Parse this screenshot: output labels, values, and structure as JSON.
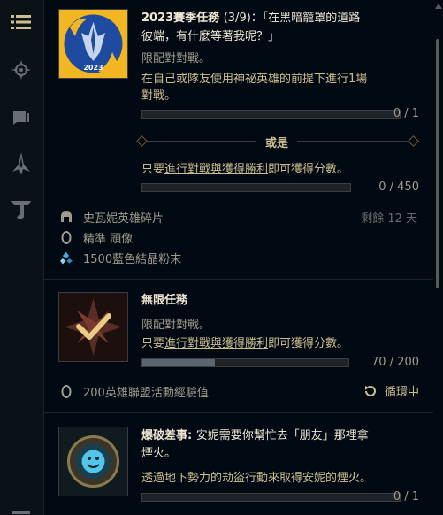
{
  "sidebar": {
    "items": [
      {
        "name": "list-icon",
        "active": true
      },
      {
        "name": "compass-icon"
      },
      {
        "name": "book-icon"
      },
      {
        "name": "crest-icon"
      },
      {
        "name": "tft-icon"
      }
    ]
  },
  "missions": [
    {
      "title": "2023賽季任務",
      "title_rest": "(3/9)：「在黑暗籠罩的道路",
      "title_line2": "彼端，有什麼等著我呢？」",
      "restriction": "限配對對戰。",
      "objective1_line1": "在自己或隊友使用神祕英雄的前提下進行1場",
      "objective1_line2": "對戰。",
      "progress1": "0 / 1",
      "progress1_fraction": 0,
      "or_label": "或是",
      "objective2_prefix": "只要",
      "objective2_link": "進行對戰與獲得勝利",
      "objective2_suffix": "即可獲得分數。",
      "progress2": "0 / 450",
      "progress2_fraction": 0,
      "emblem_text": "2023",
      "rewards": [
        {
          "icon": "helmet-icon",
          "label": "史瓦妮英雄碎片"
        },
        {
          "icon": "shield-icon",
          "label": "精準 頭像"
        },
        {
          "icon": "crystal-icon",
          "label": "1500藍色結晶粉末"
        }
      ],
      "time_left": "剩餘 12 天"
    },
    {
      "title": "無限任務",
      "restriction": "限配對對戰。",
      "objective_prefix": "只要",
      "objective_link": "進行對戰與獲得勝利",
      "objective_suffix": "即可獲得分數。",
      "progress": "70 / 200",
      "progress_fraction": 0.35,
      "rewards": [
        {
          "icon": "shield-icon",
          "label": "200英雄聯盟活動經驗值"
        }
      ],
      "repeat_label": "循環中"
    },
    {
      "title": "爆破差事:",
      "title_rest": "安妮需要你幫忙去「朋友」那裡拿",
      "title_line2": "煙火。",
      "objective_line1": "透過地下勢力的劫盜行動來取得安妮的煙火。",
      "progress": "0 / 1",
      "progress_fraction": 0
    }
  ],
  "colors": {
    "background": "#010a13",
    "gold_text": "#f0e6d2",
    "body_text": "#a09b8c",
    "accent_gold": "#c8aa6e",
    "blue_emblem": "#1f4fa0"
  }
}
